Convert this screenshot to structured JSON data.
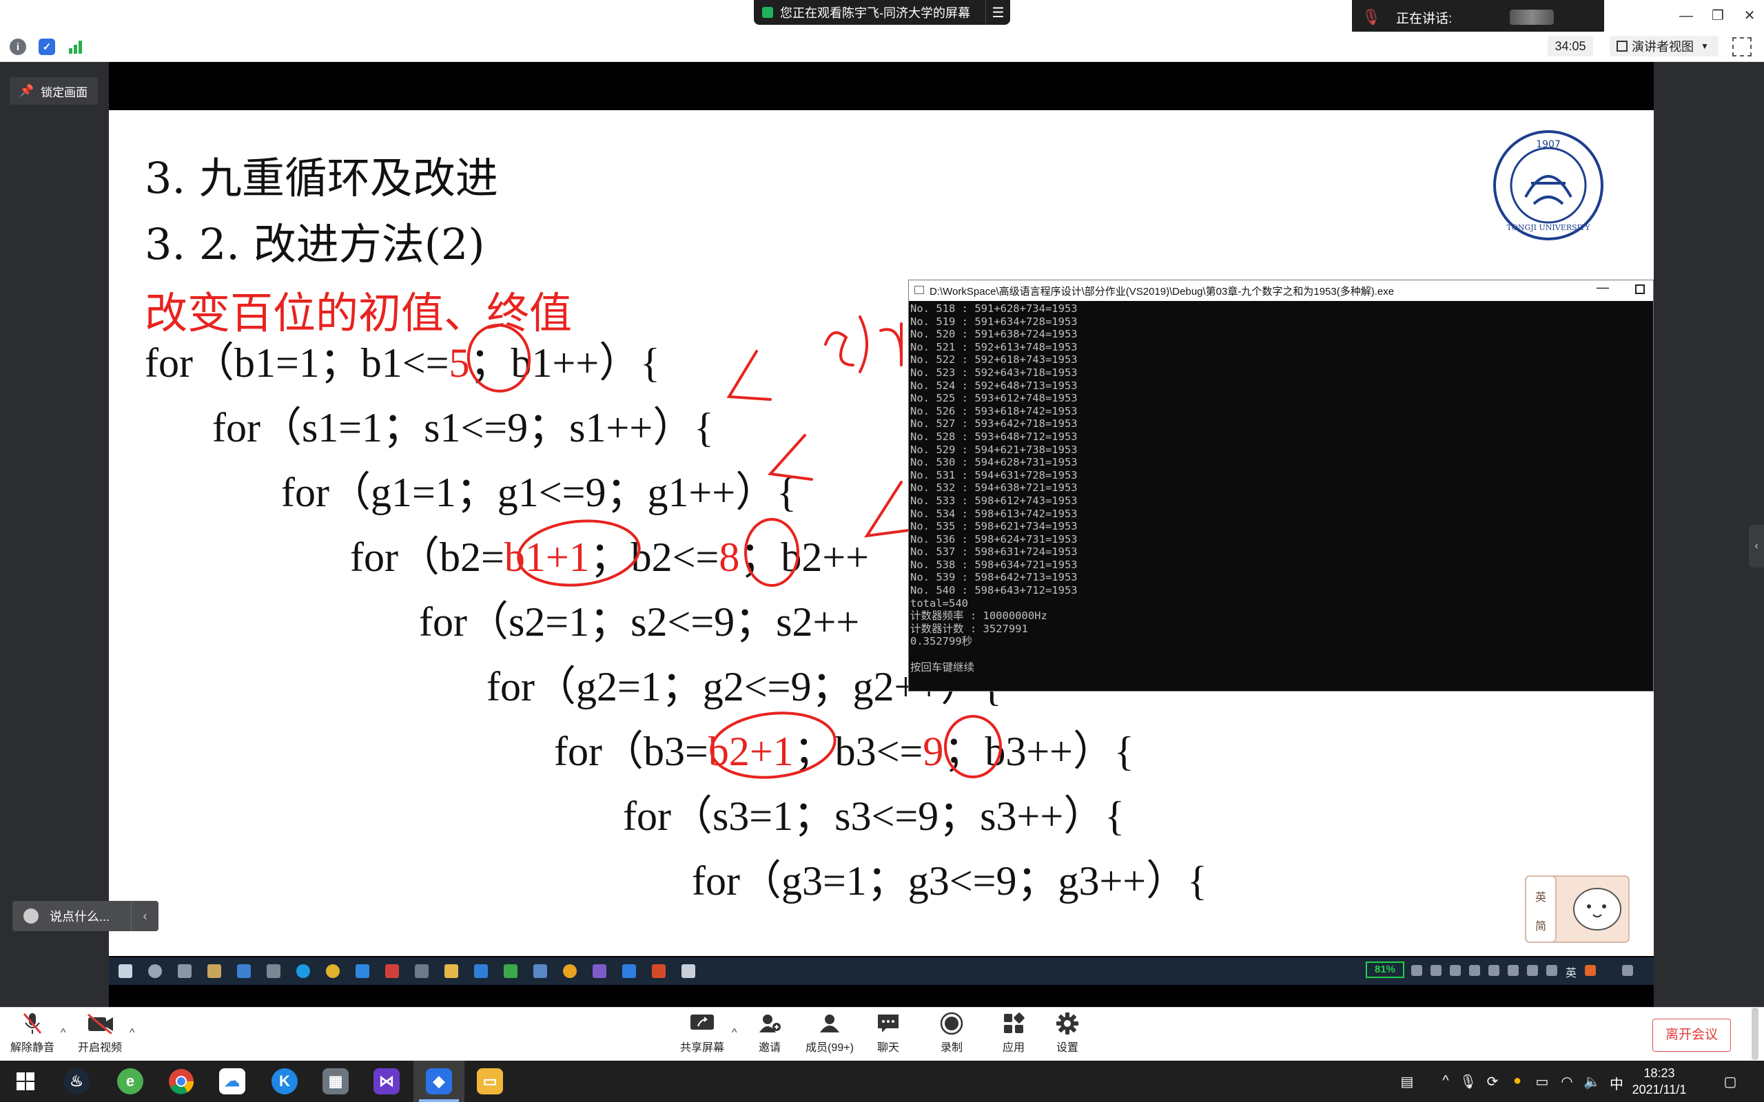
{
  "meeting": {
    "share_notice": "您正在观看陈宇飞-同济大学的屏幕",
    "speaking_label": "正在讲话:",
    "timer": "34:05",
    "view_mode": "演讲者视图",
    "lock_label": "锁定画面",
    "chat_placeholder": "说点什么..."
  },
  "slide": {
    "title1": "3. 九重循环及改进",
    "title2": "3. 2. 改进方法(2)",
    "subtitle": "改变百位的初值、终值",
    "code_lines": [
      "for（b1=1；b1<=5；b1++）{",
      "for（s1=1；s1<=9；s1++）{",
      "for（g1=1；g1<=9；g1++）{",
      "for（b2=b1+1；b2<=8；b2++",
      "for（s2=1；s2<=9；s2++",
      "for（g2=1；g2<=9；g2++）{",
      "for（b3=b2+1；b3<=9；b3++）{",
      "for（s3=1；s3<=9；s3++）{",
      "for（g3=1；g3<=9；g3++）{"
    ],
    "sticker_top": "英",
    "sticker_bottom": "简"
  },
  "console": {
    "title": "D:\\WorkSpace\\高级语言程序设计\\部分作业(VS2019)\\Debug\\第03章-九个数字之和为1953(多种解).exe",
    "lines": [
      "No. 518 : 591+628+734=1953",
      "No. 519 : 591+634+728=1953",
      "No. 520 : 591+638+724=1953",
      "No. 521 : 592+613+748=1953",
      "No. 522 : 592+618+743=1953",
      "No. 523 : 592+643+718=1953",
      "No. 524 : 592+648+713=1953",
      "No. 525 : 593+612+748=1953",
      "No. 526 : 593+618+742=1953",
      "No. 527 : 593+642+718=1953",
      "No. 528 : 593+648+712=1953",
      "No. 529 : 594+621+738=1953",
      "No. 530 : 594+628+731=1953",
      "No. 531 : 594+631+728=1953",
      "No. 532 : 594+638+721=1953",
      "No. 533 : 598+612+743=1953",
      "No. 534 : 598+613+742=1953",
      "No. 535 : 598+621+734=1953",
      "No. 536 : 598+624+731=1953",
      "No. 537 : 598+631+724=1953",
      "No. 538 : 598+634+721=1953",
      "No. 539 : 598+642+713=1953",
      "No. 540 : 598+643+712=1953",
      "total=540",
      "计数器频率 : 10000000Hz",
      "计数器计数 : 3527991",
      "0.352799秒",
      "",
      "按回车键继续"
    ]
  },
  "inner_taskbar": {
    "battery": "81%",
    "lang": "英"
  },
  "controls": {
    "unmute": "解除静音",
    "start_video": "开启视频",
    "share_screen": "共享屏幕",
    "invite": "邀请",
    "members": "成员(99+)",
    "chat": "聊天",
    "record": "录制",
    "apps": "应用",
    "settings": "设置",
    "leave": "离开会议"
  },
  "taskbar": {
    "ime": "中",
    "time": "18:23",
    "date": "2021/11/1"
  },
  "colors": {
    "accent_red": "#e8231f",
    "console_bg": "#0c0c0c",
    "taskbar_bg": "#1f1f1f",
    "leave_red": "#e03a3a"
  }
}
